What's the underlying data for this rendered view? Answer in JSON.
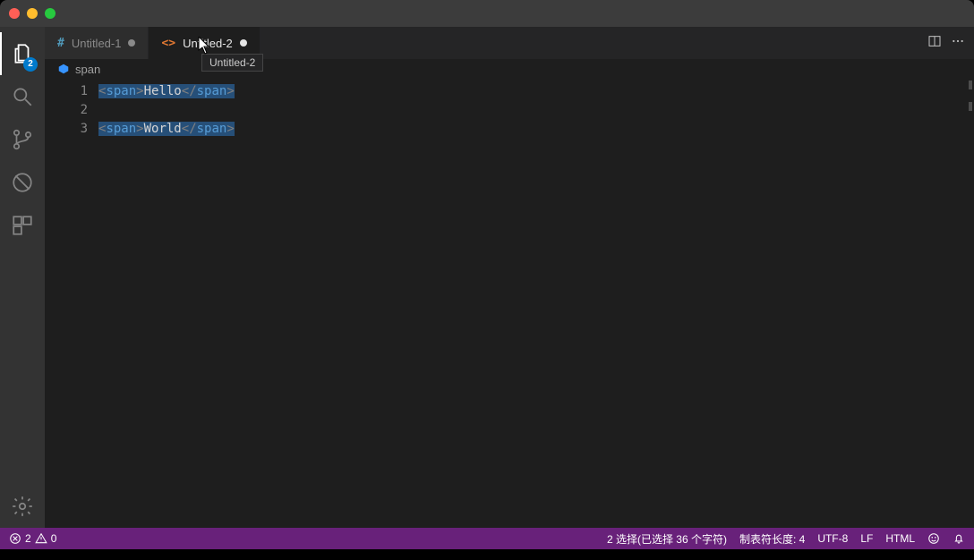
{
  "activity": {
    "explorer_badge": "2"
  },
  "tabs": [
    {
      "label": "Untitled-1",
      "icon": "#",
      "active": false
    },
    {
      "label": "Untitled-2",
      "icon": "<>",
      "active": true
    }
  ],
  "tooltip": "Untitled-2",
  "breadcrumb": {
    "symbol": "span"
  },
  "editor": {
    "line_numbers": [
      "1",
      "2",
      "3"
    ],
    "lines": [
      {
        "open_lt": "<",
        "open_tag": "span",
        "open_gt": ">",
        "text": "Hello",
        "close_lt": "<",
        "close_slash": "/",
        "close_tag": "span",
        "close_gt": ">",
        "selected": true
      },
      {
        "blank": true,
        "selected": false
      },
      {
        "open_lt": "<",
        "open_tag": "span",
        "open_gt": ">",
        "text": "World",
        "close_lt": "<",
        "close_slash": "/",
        "close_tag": "span",
        "close_gt": ">",
        "selected": true
      }
    ]
  },
  "status": {
    "errors": "2",
    "warnings": "0",
    "selection": "2 选择(已选择 36 个字符)",
    "tab_size": "制表符长度: 4",
    "encoding": "UTF-8",
    "eol": "LF",
    "language": "HTML"
  }
}
